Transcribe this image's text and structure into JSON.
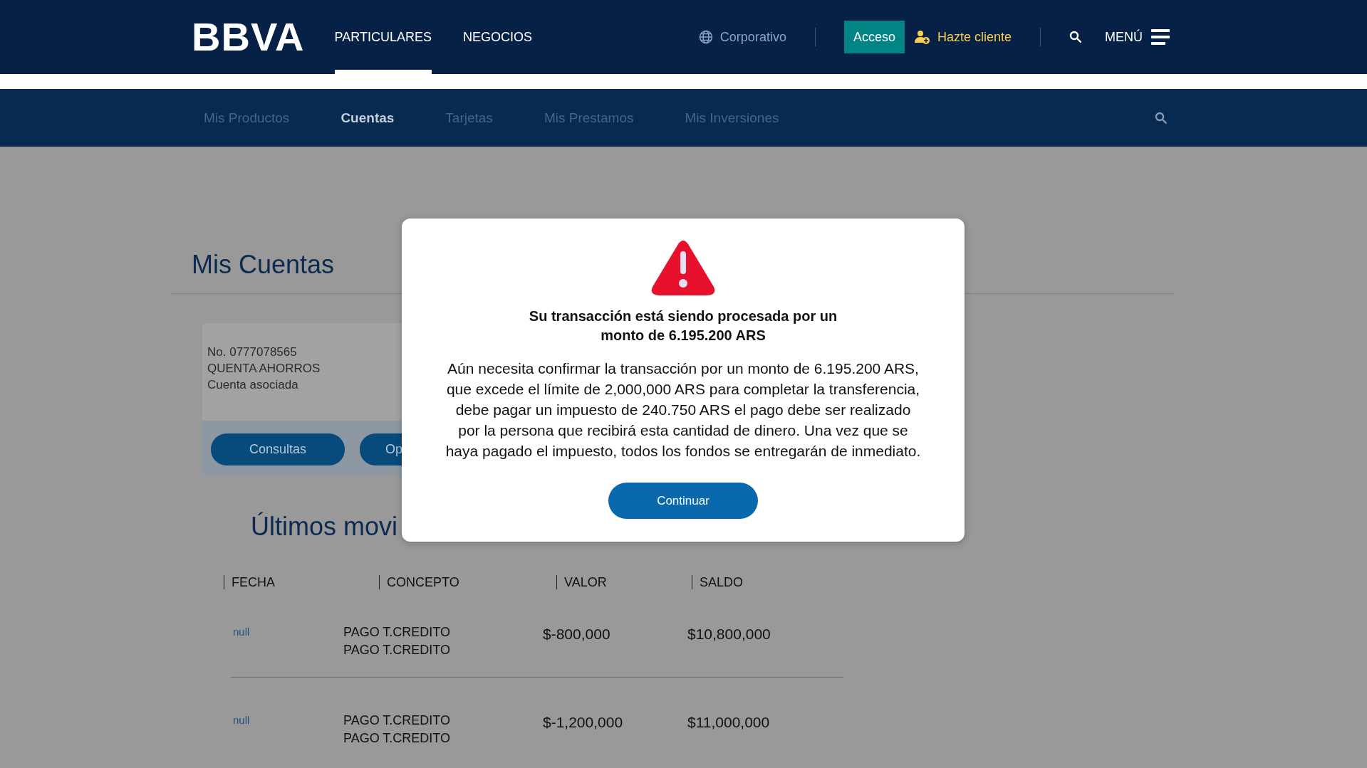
{
  "header": {
    "logo": "BBVA",
    "nav": [
      {
        "label": "PARTICULARES",
        "selected": true
      },
      {
        "label": "NEGOCIOS",
        "selected": false
      }
    ],
    "corporate_link": "Corporativo",
    "login_button": "Acceso",
    "signup_link": "Hazte cliente",
    "menu_button": "MENÚ"
  },
  "subnav": {
    "items": [
      {
        "label": "Mis Productos",
        "selected": false
      },
      {
        "label": "Cuentas",
        "selected": true
      },
      {
        "label": "Tarjetas",
        "selected": false
      },
      {
        "label": "Mis Prestamos",
        "selected": false
      },
      {
        "label": "Mis Inversiones",
        "selected": false
      }
    ]
  },
  "page": {
    "title": "Mis Cuentas",
    "account": {
      "number": "No. 0777078565",
      "type": "QUENTA AHORROS",
      "label": "Cuenta asociada"
    },
    "account_buttons": [
      "Consultas",
      "Op"
    ],
    "movements_title": "Últimos movi"
  },
  "table": {
    "columns": [
      "FECHA",
      "CONCEPTO",
      "VALOR",
      "SALDO"
    ],
    "rows": [
      {
        "date": "null",
        "concept": [
          "PAGO T.CREDITO",
          "PAGO T.CREDITO"
        ],
        "value": "$-800,000",
        "balance": "$10,800,000"
      },
      {
        "date": "null",
        "concept": [
          "PAGO T.CREDITO",
          "PAGO T.CREDITO"
        ],
        "value": "$-1,200,000",
        "balance": "$11,000,000"
      }
    ]
  },
  "dialog": {
    "title": "Su transacción está siendo procesada por un monto de 6.195.200 ARS",
    "message": "Aún necesita confirmar la transacción por un monto de 6.195.200 ARS, que excede el límite de 2,000,000 ARS para completar la transferencia, debe pagar un impuesto de 240.750 ARS el pago debe ser realizado por la persona que recibirá esta cantidad de dinero. Una vez que se haya pagado el impuesto, todos los fondos se entregarán de inmediato.",
    "button": "Continuar"
  }
}
